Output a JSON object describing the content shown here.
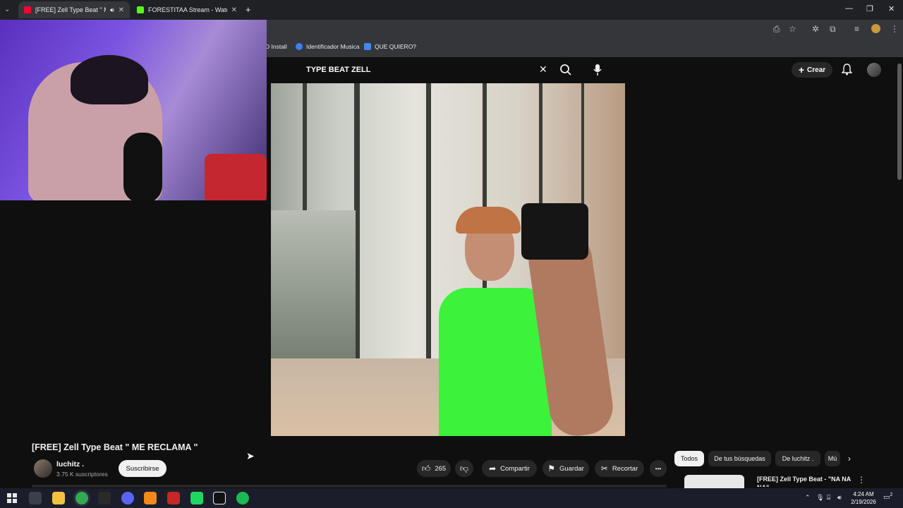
{
  "browser": {
    "tabs": [
      {
        "label": "[FREE] Zell Type Beat \" ME R",
        "favicon_color": "#ff0033",
        "active": true
      },
      {
        "label": "FORESTITAA Stream - Watch Li",
        "favicon_color": "#53fc18",
        "active": false
      }
    ],
    "new_tab": "+",
    "tab_close": "✕",
    "window_controls": {
      "minimize": "—",
      "restore": "❐",
      "close": "✕"
    },
    "bookmarks": [
      {
        "label": "D Install",
        "icon": "bookmark-icon"
      },
      {
        "label": "Identificador Musica",
        "icon": "shazam-icon",
        "color": "#3b7ff2"
      },
      {
        "label": "QUE QUIERO?",
        "icon": "docs-icon",
        "color": "#4285f4"
      }
    ]
  },
  "youtube": {
    "search_query": "TYPE BEAT ZELL",
    "create_label": "Crear",
    "video": {
      "title": "[FREE] Zell Type Beat \" ME RECLAMA \"",
      "channel": "luchitz .",
      "subscribers": "3.75 K suscriptores",
      "subscribe_label": "Suscribirse",
      "likes": "265",
      "share_label": "Compartir",
      "save_label": "Guardar",
      "clip_label": "Recortar",
      "more_label": "•••"
    },
    "chips": [
      "Todos",
      "De tus búsquedas",
      "De luchitz .",
      "Mú"
    ],
    "recommendation": {
      "title": "[FREE] Zell Type Beat - \"NA NA NA\""
    }
  },
  "taskbar": {
    "time": "4:24 AM",
    "date": "2/19/2026",
    "notification_count": "2",
    "apps": [
      {
        "name": "start-icon",
        "color": "#1b1e2a"
      },
      {
        "name": "task-view-icon",
        "color": "#3a3f4b"
      },
      {
        "name": "file-explorer-icon",
        "color": "#f3c043"
      },
      {
        "name": "chrome-icon",
        "color": "#34a853"
      },
      {
        "name": "epic-games-icon",
        "color": "#2a2a2a"
      },
      {
        "name": "discord-icon",
        "color": "#5865f2"
      },
      {
        "name": "fl-studio-icon",
        "color": "#f08a1c"
      },
      {
        "name": "voicemeeter-icon",
        "color": "#c62828"
      },
      {
        "name": "kick-icon",
        "color": "#1ed760"
      },
      {
        "name": "capcut-icon",
        "color": "#111111"
      },
      {
        "name": "spotify-icon",
        "color": "#1db954"
      }
    ]
  }
}
